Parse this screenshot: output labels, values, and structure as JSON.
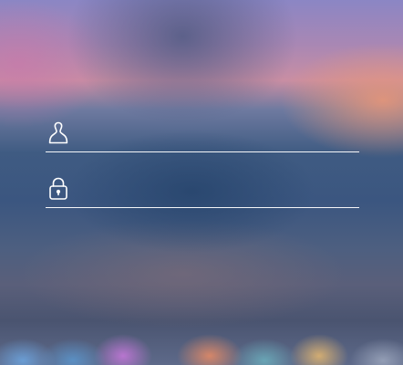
{
  "login": {
    "username": {
      "icon": "user-icon",
      "value": "",
      "placeholder": ""
    },
    "password": {
      "icon": "lock-icon",
      "value": "",
      "placeholder": ""
    }
  },
  "colors": {
    "field_line": "#ffffff",
    "icon_stroke": "#ffffff"
  }
}
